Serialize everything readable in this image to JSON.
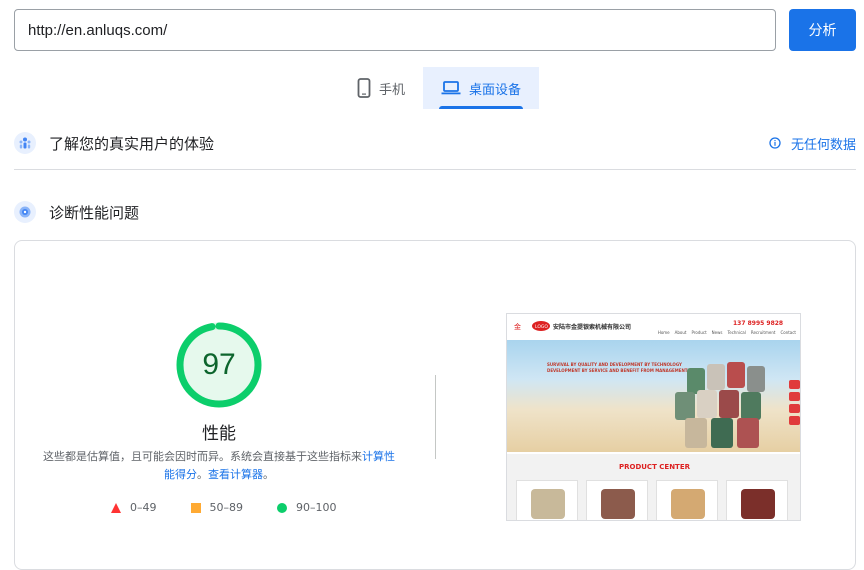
{
  "url_input": {
    "value": "http://en.anluqs.com/"
  },
  "analyze_button": {
    "label": "分析"
  },
  "tabs": [
    {
      "label": "手机",
      "icon": "smartphone-icon",
      "active": false
    },
    {
      "label": "桌面设备",
      "icon": "laptop-icon",
      "active": true
    }
  ],
  "field_data": {
    "title": "了解您的真实用户的体验",
    "right_label": "无任何数据",
    "icon": "users-icon",
    "right_icon": "info-icon"
  },
  "diagnostics": {
    "title": "诊断性能问题",
    "icon": "lab-icon"
  },
  "performance": {
    "score": "97",
    "label": "性能",
    "desc_text": "这些都是估算值，且可能会因时而异。系统会直接基于这些指标来",
    "desc_link": "计算性能得分",
    "desc_sep": "。",
    "calc_link": "查看计算器",
    "desc_end": "。",
    "score_value": 97,
    "color": "#0cce6b"
  },
  "legend": [
    {
      "range": "0–49",
      "shape": "triangle",
      "color": "#ff3333"
    },
    {
      "range": "50–89",
      "shape": "square",
      "color": "#ffaa33"
    },
    {
      "range": "90–100",
      "shape": "circle",
      "color": "#0cce6b"
    }
  ],
  "screenshot": {
    "company": "安陆市金提银索机械有限公司",
    "phone": "137 8995 9828",
    "nav": [
      "Home",
      "About",
      "Product",
      "News",
      "Technical",
      "Recruitment",
      "Contact"
    ],
    "hero_text": [
      "SURVIVAL BY QUALITY AND DEVELOPMENT BY TECHNOLOGY",
      "DEVELOPMENT BY SERVICE AND BENEFIT FROM MANAGEMENT"
    ],
    "product_center": "PRODUCT CENTER"
  }
}
